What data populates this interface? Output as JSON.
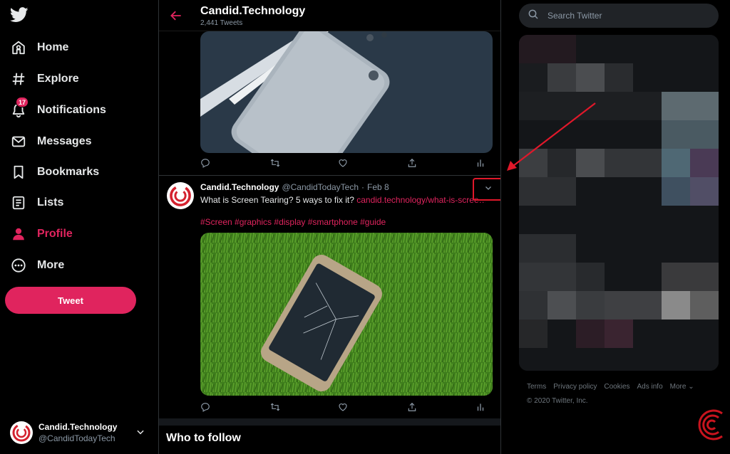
{
  "nav": {
    "items": [
      {
        "label": "Home",
        "icon": "home-icon"
      },
      {
        "label": "Explore",
        "icon": "hashtag-icon"
      },
      {
        "label": "Notifications",
        "icon": "bell-icon",
        "badge": "17"
      },
      {
        "label": "Messages",
        "icon": "envelope-icon"
      },
      {
        "label": "Bookmarks",
        "icon": "bookmark-icon"
      },
      {
        "label": "Lists",
        "icon": "list-icon"
      },
      {
        "label": "Profile",
        "icon": "person-icon",
        "active": true
      },
      {
        "label": "More",
        "icon": "more-icon"
      }
    ],
    "tweet_button": "Tweet",
    "account": {
      "name": "Candid.Technology",
      "handle": "@CandidTodayTech"
    }
  },
  "header": {
    "title": "Candid.Technology",
    "subtitle": "2,441 Tweets"
  },
  "tweet": {
    "name": "Candid.Technology",
    "handle": "@CandidTodayTech",
    "dot": "·",
    "date": "Feb 8",
    "text": "What is Screen Tearing? 5 ways to fix it? ",
    "link": "candid.technology/what-is-scree…",
    "hashtags": "#Screen #graphics #display #smartphone #guide"
  },
  "who_to_follow": "Who to follow",
  "search": {
    "placeholder": "Search Twitter"
  },
  "footer": {
    "links": [
      "Terms",
      "Privacy policy",
      "Cookies",
      "Ads info",
      "More"
    ],
    "copyright": "© 2020 Twitter, Inc."
  },
  "colors": {
    "accent": "#e0245e",
    "annotation": "#e0182a",
    "background": "#000000"
  }
}
